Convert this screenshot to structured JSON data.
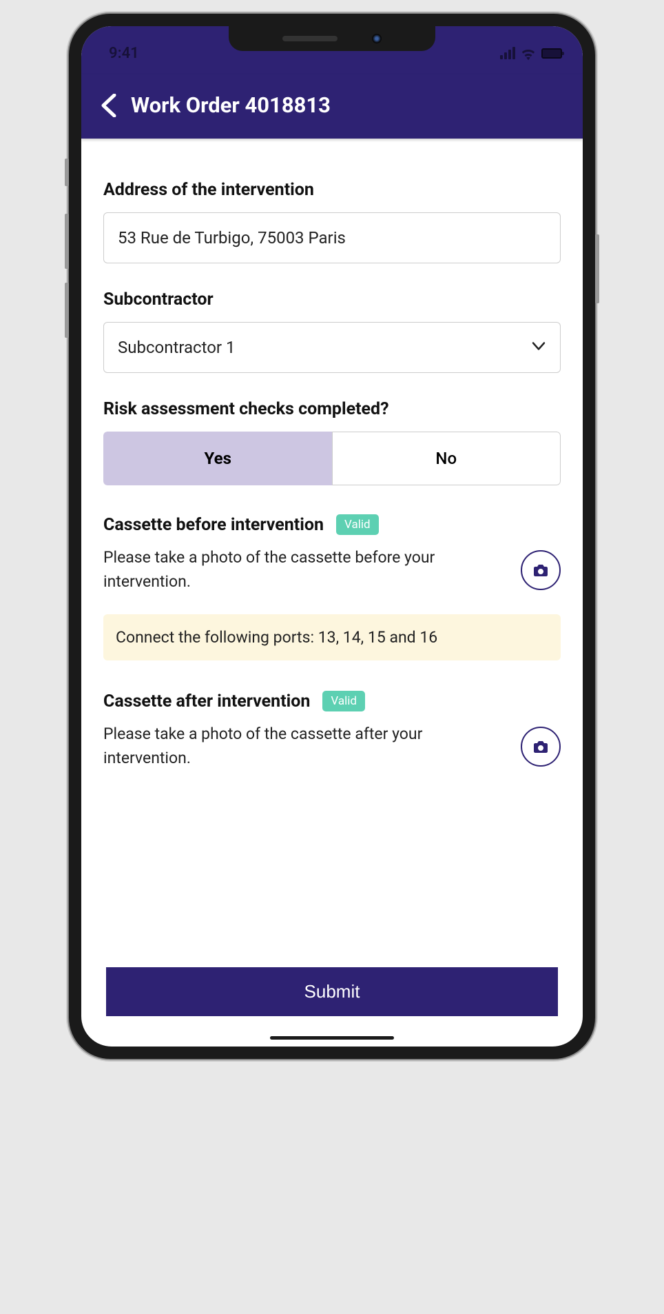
{
  "status_bar": {
    "time": "9:41"
  },
  "header": {
    "title": "Work Order 4018813"
  },
  "form": {
    "address_label": "Address of the intervention",
    "address_value": "53 Rue de Turbigo, 75003 Paris",
    "subcontractor_label": "Subcontractor",
    "subcontractor_value": "Subcontractor 1",
    "risk_label": "Risk assessment checks completed?",
    "risk_options": {
      "yes": "Yes",
      "no": "No"
    },
    "risk_selected": "yes",
    "before": {
      "title": "Cassette before intervention",
      "badge": "Valid",
      "instruction": "Please take a photo of the cassette before your intervention."
    },
    "ports_info": "Connect the following ports: 13, 14, 15 and 16",
    "after": {
      "title": "Cassette after intervention",
      "badge": "Valid",
      "instruction": "Please take a photo of the cassette after your intervention."
    },
    "submit_label": "Submit"
  }
}
